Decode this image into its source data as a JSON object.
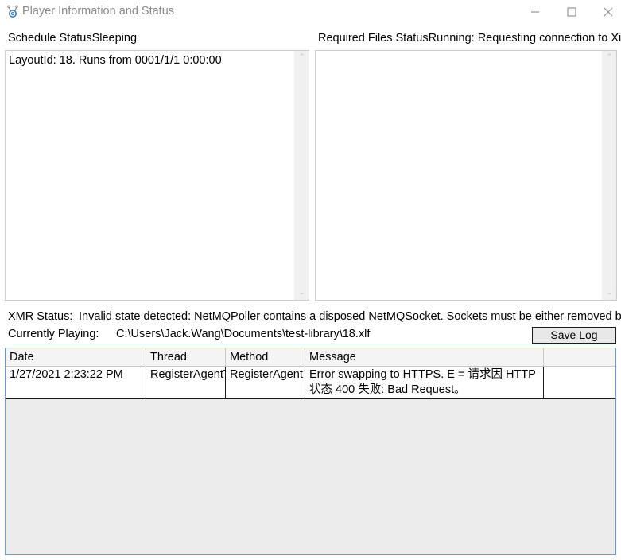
{
  "window": {
    "title": "Player Information and Status",
    "icon": "xibo-player-icon",
    "controls": {
      "minimize": "minimize-icon",
      "maximize": "maximize-icon",
      "close": "close-icon"
    }
  },
  "status": {
    "schedule_label": "Schedule Status",
    "schedule_value": "Sleeping",
    "schedule_combined": "Schedule StatusSleeping",
    "required_files_label": "Required Files Status",
    "required_files_value": "Running: Requesting connection to Xibo Ser",
    "required_files_combined": "Required Files StatusRunning: Requesting connection to Xibo Ser"
  },
  "panels": {
    "schedule": {
      "text": "LayoutId: 18. Runs from 0001/1/1 0:00:00",
      "scroll_up": "⌃",
      "scroll_down": "⌄"
    },
    "required_files": {
      "text": "",
      "scroll_up": "⌃",
      "scroll_down": "⌄"
    }
  },
  "info": {
    "xmr_label": "XMR Status:",
    "xmr_value": "Invalid state detected: NetMQPoller contains a disposed NetMQSocket. Sockets must be either removed before being",
    "playing_label": "Currently Playing:",
    "playing_value": "C:\\Users\\Jack.Wang\\Documents\\test-library\\18.xlf"
  },
  "toolbar": {
    "save_log_label": "Save Log"
  },
  "log_grid": {
    "columns": [
      "Date",
      "Thread",
      "Method",
      "Message",
      ""
    ],
    "rows": [
      {
        "date": "1/27/2021 2:23:22 PM",
        "thread": "RegisterAgentTh",
        "method": "RegisterAgent - ",
        "message": "Error swapping to HTTPS. E = 请求因 HTTP 状态 400 失败: Bad Request。",
        "extra": ""
      }
    ]
  },
  "colors": {
    "title_text": "#8a8a8a",
    "icon_blue": "#3b7ec0",
    "grid_border": "#7799bb",
    "grid_body_bg": "#ececec",
    "button_bg": "#e8e8e8"
  }
}
